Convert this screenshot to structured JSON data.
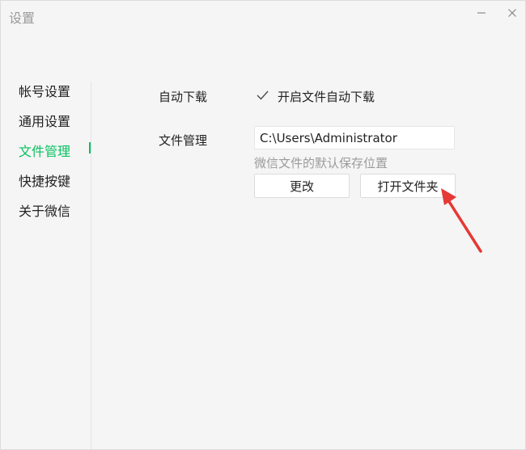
{
  "window": {
    "title": "设置"
  },
  "sidebar": {
    "items": [
      {
        "label": "帐号设置",
        "active": false
      },
      {
        "label": "通用设置",
        "active": false
      },
      {
        "label": "文件管理",
        "active": true
      },
      {
        "label": "快捷按键",
        "active": false
      },
      {
        "label": "关于微信",
        "active": false
      }
    ]
  },
  "main": {
    "auto_download": {
      "label": "自动下载",
      "checkbox_label": "开启文件自动下载",
      "checked": true
    },
    "file_management": {
      "label": "文件管理",
      "path_value": "C:\\Users\\Administrator",
      "hint": "微信文件的默认保存位置",
      "change_button": "更改",
      "open_folder_button": "打开文件夹"
    }
  },
  "colors": {
    "accent": "#07c160",
    "arrow": "#e53935",
    "background": "#f5f5f5"
  },
  "icons": {
    "minimize": "minimize-icon",
    "close": "close-icon",
    "checkmark": "checkmark-icon",
    "annotation": "red-arrow-annotation"
  }
}
